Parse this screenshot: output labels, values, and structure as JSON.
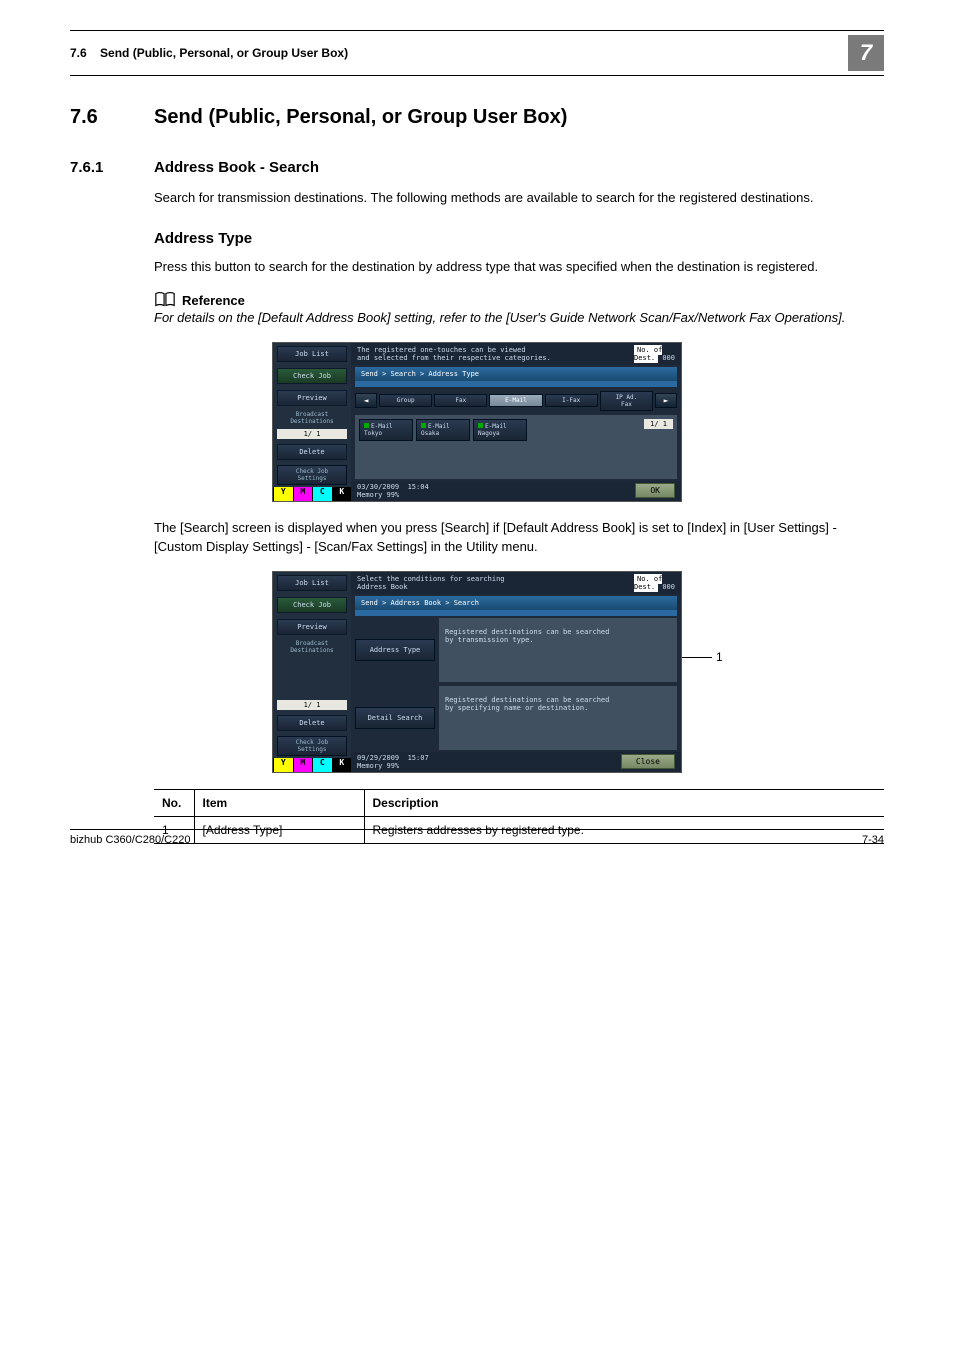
{
  "header": {
    "section_no": "7.6",
    "section_title": "Send (Public, Personal, or Group User Box)",
    "chapter_no": "7"
  },
  "h1": {
    "num": "7.6",
    "title": "Send (Public, Personal, or Group User Box)"
  },
  "h2": {
    "num": "7.6.1",
    "title": "Address Book - Search"
  },
  "p1": "Search for transmission destinations. The following methods are available to search for the registered destinations.",
  "h3a": "Address Type",
  "p2": "Press this button to search for the destination by address type that was specified when the destination is registered.",
  "ref_label": "Reference",
  "ref_text": "For details on the [Default Address Book] setting, refer to the [User's Guide Network Scan/Fax/Network Fax Operations].",
  "shot1": {
    "left": {
      "job_list": "Job List",
      "check_job": "Check Job",
      "preview": "Preview",
      "broadcast": "Broadcast\nDestinations",
      "page": "1/  1",
      "delete": "Delete",
      "check_set": "Check Job\nSettings"
    },
    "top_msg": "The registered one-touches can be viewed\nand selected from their respective categories.",
    "dest_label": "No. of\nDest.",
    "dest_count": "000",
    "breadcrumb": "Send > Search > Address Type",
    "tabs": [
      "Group",
      "Fax",
      "E-Mail",
      "I-Fax",
      "IP Ad.\nFax"
    ],
    "cards": [
      {
        "type": "E-Mail",
        "name": "Tokyo"
      },
      {
        "type": "E-Mail",
        "name": "Osaka"
      },
      {
        "type": "E-Mail",
        "name": "Nagoya"
      }
    ],
    "body_page": "1/  1",
    "date": "03/30/2009",
    "time": "15:04",
    "mem": "Memory    99%",
    "ok": "OK"
  },
  "p3": "The [Search] screen is displayed when you press [Search] if [Default Address Book] is set to [Index] in [User Settings] - [Custom Display Settings] - [Scan/Fax Settings] in the Utility menu.",
  "shot2": {
    "left": {
      "job_list": "Job List",
      "check_job": "Check Job",
      "preview": "Preview",
      "broadcast": "Broadcast\nDestinations",
      "page": "1/  1",
      "delete": "Delete",
      "check_set": "Check Job\nSettings"
    },
    "top_msg": "Select the conditions for searching\nAddress Book",
    "dest_label": "No. of\nDest.",
    "dest_count": "000",
    "breadcrumb": "Send > Address Book > Search",
    "panel1_btn": "Address Type",
    "panel1_text": "Registered destinations can be searched\nby transmission type.",
    "panel2_btn": "Detail Search",
    "panel2_text": "Registered destinations can be searched\nby specifying name or destination.",
    "date": "09/29/2009",
    "time": "15:07",
    "mem": "Memory    99%",
    "close": "Close"
  },
  "callout1": "1",
  "table": {
    "head": {
      "no": "No.",
      "item": "Item",
      "desc": "Description"
    },
    "rows": [
      {
        "no": "1",
        "item": "[Address Type]",
        "desc": "Registers addresses by registered type."
      }
    ]
  },
  "footer": {
    "left": "bizhub C360/C280/C220",
    "right": "7-34"
  }
}
